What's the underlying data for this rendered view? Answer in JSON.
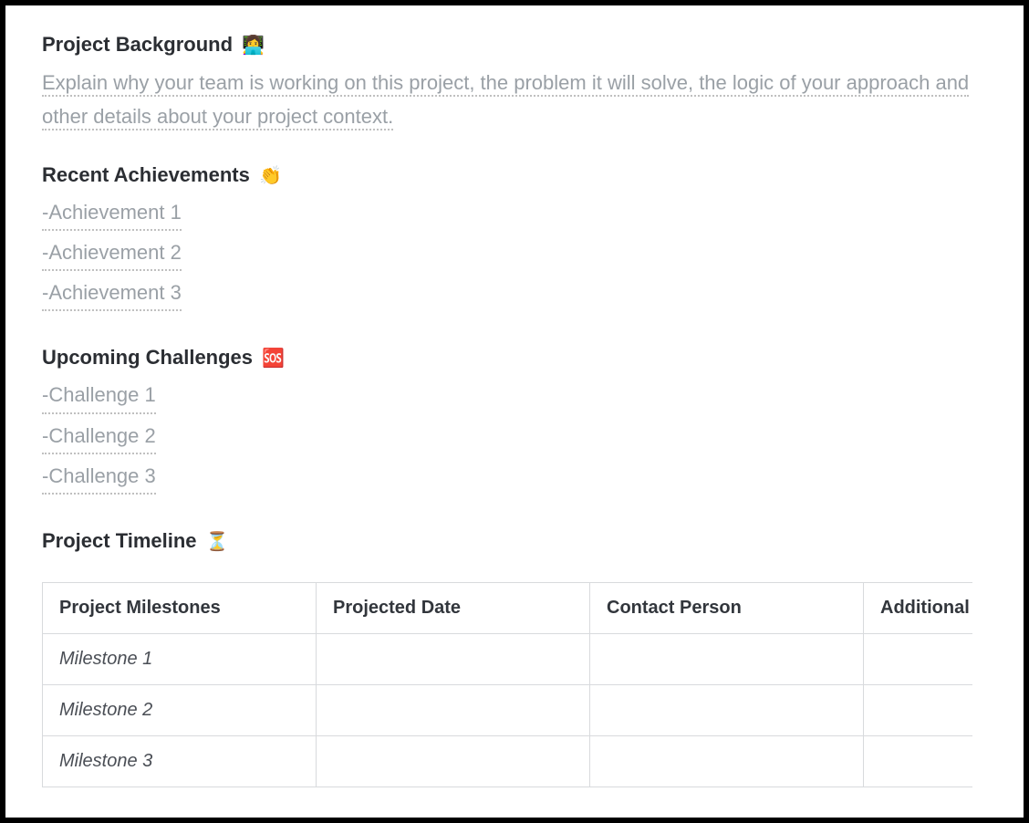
{
  "sections": {
    "background": {
      "title": "Project Background",
      "emoji": "👩‍💻",
      "placeholder": "Explain why your team is working on this project, the problem it will solve, the logic of your approach and other details about your project context."
    },
    "achievements": {
      "title": "Recent Achievements",
      "emoji": "👏",
      "items": [
        "-Achievement 1",
        "-Achievement 2",
        "-Achievement 3"
      ]
    },
    "challenges": {
      "title": "Upcoming Challenges",
      "emoji": "🆘",
      "items": [
        "-Challenge 1",
        "-Challenge 2",
        "-Challenge 3"
      ]
    },
    "timeline": {
      "title": "Project Timeline",
      "emoji": "⏳",
      "columns": [
        "Project Milestones",
        "Projected Date",
        "Contact Person",
        "Additional"
      ],
      "rows": [
        {
          "milestone": "Milestone 1",
          "date": "",
          "contact": "",
          "additional": ""
        },
        {
          "milestone": "Milestone 2",
          "date": "",
          "contact": "",
          "additional": ""
        },
        {
          "milestone": "Milestone 3",
          "date": "",
          "contact": "",
          "additional": ""
        }
      ]
    }
  }
}
